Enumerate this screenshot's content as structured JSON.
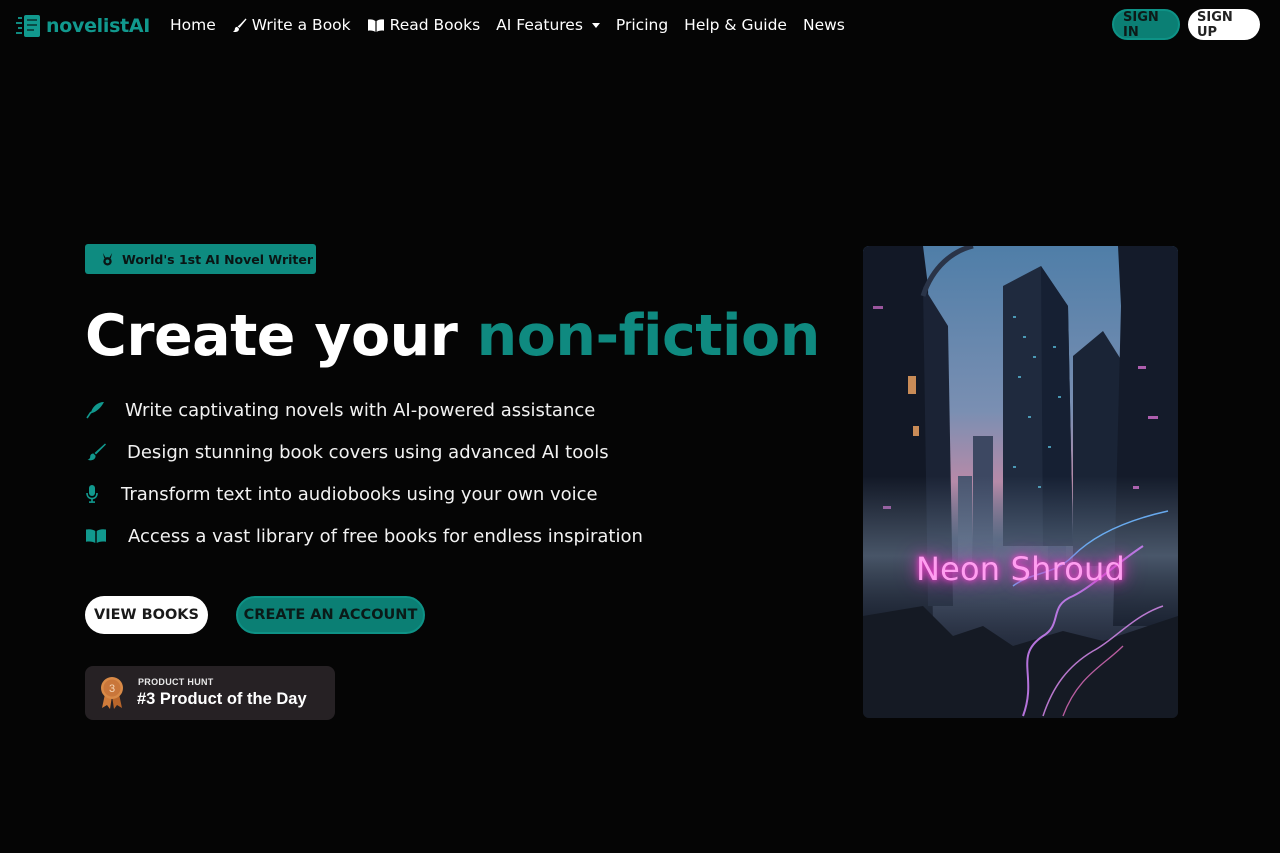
{
  "brand": {
    "name": "novelistAI",
    "logo_icon": "book-stack-logo-icon",
    "color": "#11998e"
  },
  "nav": {
    "items": [
      {
        "label": "Home",
        "icon": ""
      },
      {
        "label": "Write a Book",
        "icon": "paintbrush-icon"
      },
      {
        "label": "Read Books",
        "icon": "open-book-icon"
      },
      {
        "label": "AI Features",
        "icon": "",
        "dropdown": true
      },
      {
        "label": "Pricing",
        "icon": ""
      },
      {
        "label": "Help & Guide",
        "icon": ""
      },
      {
        "label": "News",
        "icon": ""
      }
    ]
  },
  "auth": {
    "sign_in": "SIGN IN",
    "sign_up": "SIGN UP"
  },
  "hero": {
    "badge": "World's 1st AI Novel Writer",
    "headline_lead": "Create your ",
    "headline_accent": "non-fiction",
    "accent_color": "#0f8a80",
    "features": [
      {
        "icon": "quill-icon",
        "text": "Write captivating novels with AI-powered assistance"
      },
      {
        "icon": "paintbrush-icon",
        "text": "Design stunning book covers using advanced AI tools"
      },
      {
        "icon": "microphone-icon",
        "text": "Transform text into audiobooks using your own voice"
      },
      {
        "icon": "open-book-icon",
        "text": "Access a vast library of free books for endless inspiration"
      }
    ],
    "view_books": "VIEW BOOKS",
    "create_account": "CREATE AN ACCOUNT"
  },
  "product_hunt": {
    "small": "PRODUCT HUNT",
    "big": "#3 Product of the Day",
    "medal_number": "3"
  },
  "cover": {
    "title": "Neon Shroud"
  }
}
